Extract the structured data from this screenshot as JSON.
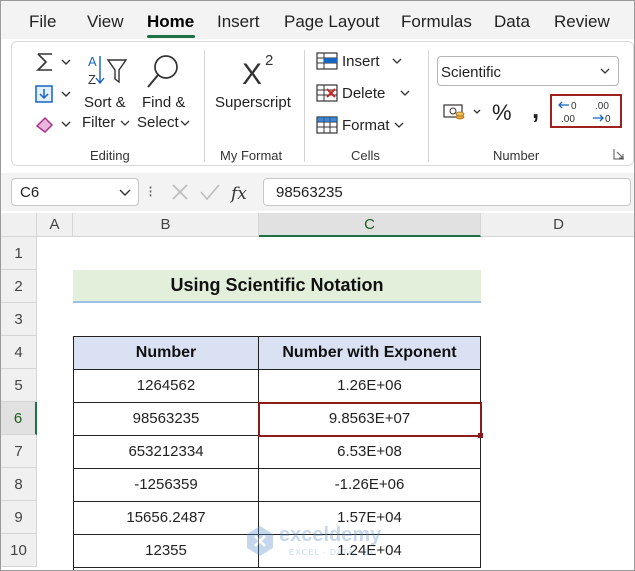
{
  "menu": {
    "items": [
      "File",
      "View",
      "Home",
      "Insert",
      "Page Layout",
      "Formulas",
      "Data",
      "Review"
    ],
    "active": "Home"
  },
  "ribbon": {
    "editing": {
      "sort_filter_line1": "Sort &",
      "sort_filter_line2": "Filter",
      "find_select_line1": "Find &",
      "find_select_line2": "Select",
      "group_label": "Editing"
    },
    "my_format": {
      "superscript_label": "Superscript",
      "group_label": "My Format"
    },
    "cells": {
      "insert_label": "Insert",
      "delete_label": "Delete",
      "format_label": "Format",
      "group_label": "Cells"
    },
    "number": {
      "format_select": "Scientific",
      "percent_symbol": "%",
      "comma_symbol": ",",
      "group_label": "Number"
    }
  },
  "formula_bar": {
    "name_box": "C6",
    "formula": "98563235"
  },
  "grid": {
    "columns": [
      "A",
      "B",
      "C",
      "D"
    ],
    "rows": [
      "1",
      "2",
      "3",
      "4",
      "5",
      "6",
      "7",
      "8",
      "9",
      "10"
    ],
    "selected_column": "C",
    "selected_row": "6"
  },
  "sheet": {
    "title": "Using Scientific Notation",
    "table_headers": [
      "Number",
      "Number with Exponent"
    ],
    "table_rows": [
      [
        "1264562",
        "1.26E+06"
      ],
      [
        "98563235",
        "9.8563E+07"
      ],
      [
        "653212334",
        "6.53E+08"
      ],
      [
        "-1256359",
        "-1.26E+06"
      ],
      [
        "15656.2487",
        "1.57E+04"
      ],
      [
        "12355",
        "1.24E+04"
      ]
    ]
  },
  "watermark": {
    "brand": "exceldemy",
    "tagline": "EXCEL · DATA · BI"
  },
  "colors": {
    "accent_green": "#1e7145",
    "title_fill": "#e2efda",
    "header_fill": "#d9e1f2",
    "highlight_border": "#8b1a1a"
  }
}
